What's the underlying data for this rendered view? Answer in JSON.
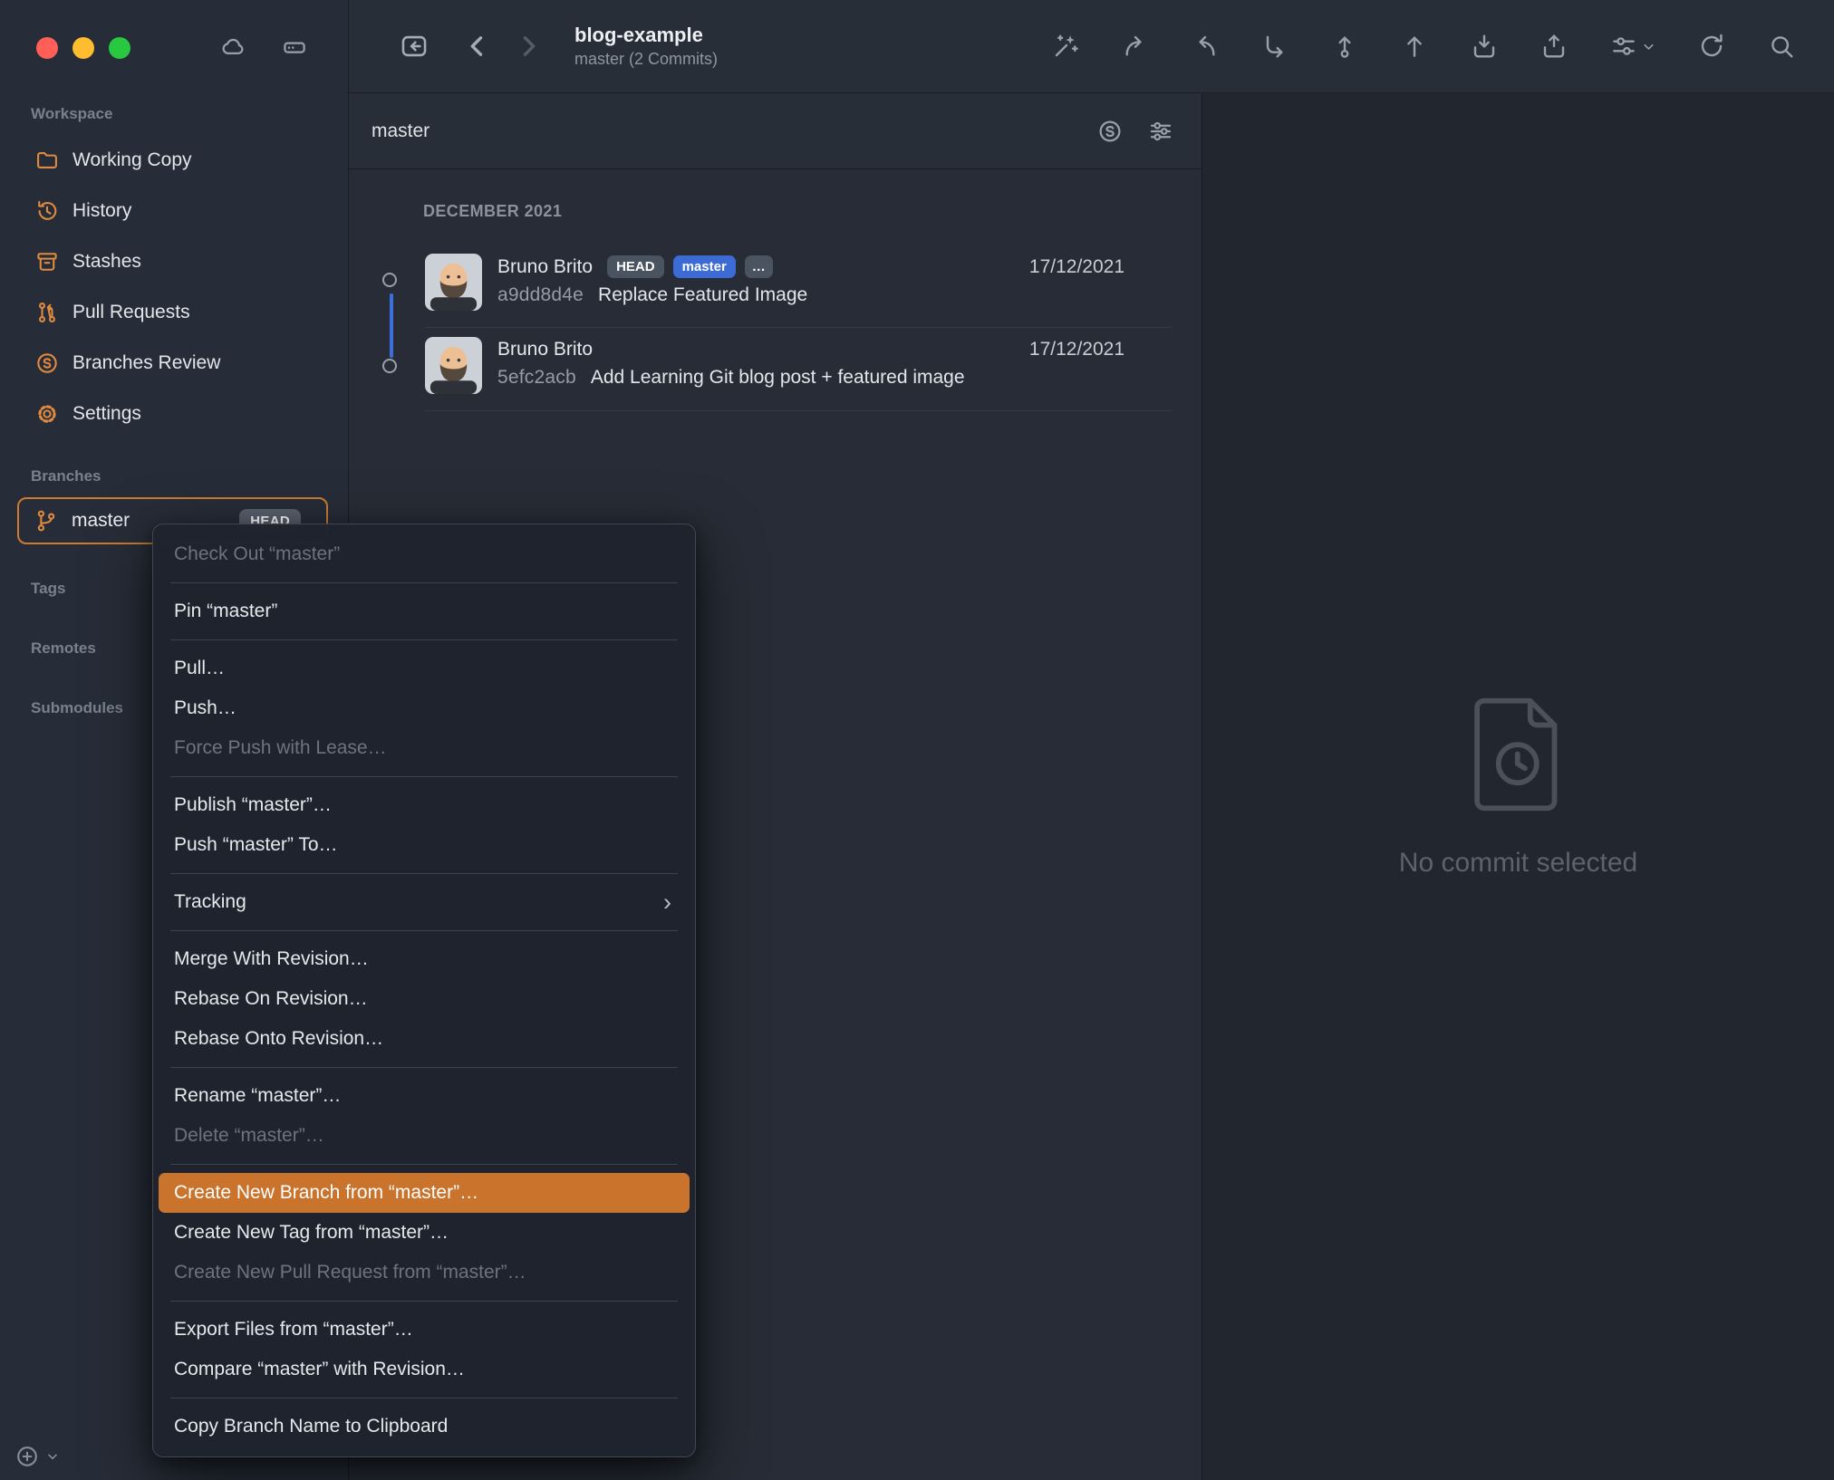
{
  "colors": {
    "accent_orange": "#c9732c",
    "badge_blue": "#3c6bd6",
    "badge_grey": "#4a5360",
    "graph_blue": "#3e6fd8",
    "icon_orange": "#df8a3e",
    "selection_outline": "#cd7a33"
  },
  "window": {
    "title": "blog-example",
    "subtitle": "master (2 Commits)"
  },
  "toolbar": {
    "icon_names": [
      "show-repositories-icon",
      "back-icon",
      "forward-icon",
      "quick-actions-icon",
      "checkout-icon",
      "merge-icon",
      "rebase-icon",
      "commit-icon",
      "push-icon",
      "stash-icon",
      "apply-stash-icon",
      "workflow-options-icon",
      "chevron-down-icon",
      "refresh-icon",
      "search-icon"
    ]
  },
  "sidebar": {
    "workspace_label": "Workspace",
    "workspace_items": [
      {
        "label": "Working Copy",
        "icon": "working-copy-folder-icon"
      },
      {
        "label": "History",
        "icon": "history-clock-icon"
      },
      {
        "label": "Stashes",
        "icon": "stashes-icon"
      },
      {
        "label": "Pull Requests",
        "icon": "pull-requests-icon"
      },
      {
        "label": "Branches Review",
        "icon": "branches-review-icon"
      },
      {
        "label": "Settings",
        "icon": "settings-gear-icon"
      }
    ],
    "branches_label": "Branches",
    "branch_item": {
      "name": "master",
      "badge": "HEAD"
    },
    "tags_label": "Tags",
    "remotes_label": "Remotes",
    "submodules_label": "Submodules"
  },
  "commit_panel": {
    "filter_value": "master",
    "filter_icons": [
      "compare-branch-icon",
      "filter-options-icon"
    ],
    "group_header": "DECEMBER 2021",
    "commits": [
      {
        "author": "Bruno Brito",
        "badges": [
          {
            "label": "HEAD",
            "type": "head"
          },
          {
            "label": "master",
            "type": "branch"
          },
          {
            "label": "…",
            "type": "more"
          }
        ],
        "date": "17/12/2021",
        "hash": "a9dd8d4e",
        "message": "Replace Featured Image"
      },
      {
        "author": "Bruno Brito",
        "badges": [],
        "date": "17/12/2021",
        "hash": "5efc2acb",
        "message": "Add Learning Git blog post + featured image"
      }
    ]
  },
  "detail_panel": {
    "empty_message": "No commit selected"
  },
  "context_menu": {
    "groups": [
      [
        {
          "label": "Check Out “master”",
          "state": "disabled"
        }
      ],
      [
        {
          "label": "Pin “master”"
        }
      ],
      [
        {
          "label": "Pull…"
        },
        {
          "label": "Push…"
        },
        {
          "label": "Force Push with Lease…",
          "state": "disabled"
        }
      ],
      [
        {
          "label": "Publish “master”…"
        },
        {
          "label": "Push “master” To…"
        }
      ],
      [
        {
          "label": "Tracking",
          "submenu": true
        }
      ],
      [
        {
          "label": "Merge With Revision…"
        },
        {
          "label": "Rebase On Revision…"
        },
        {
          "label": "Rebase Onto Revision…"
        }
      ],
      [
        {
          "label": "Rename “master”…"
        },
        {
          "label": "Delete “master”…",
          "state": "disabled"
        }
      ],
      [
        {
          "label": "Create New Branch from “master”…",
          "state": "highlighted"
        },
        {
          "label": "Create New Tag from “master”…"
        },
        {
          "label": "Create New Pull Request from “master”…",
          "state": "disabled"
        }
      ],
      [
        {
          "label": "Export Files from “master”…"
        },
        {
          "label": "Compare “master” with Revision…"
        }
      ],
      [
        {
          "label": "Copy Branch Name to Clipboard"
        }
      ]
    ]
  }
}
